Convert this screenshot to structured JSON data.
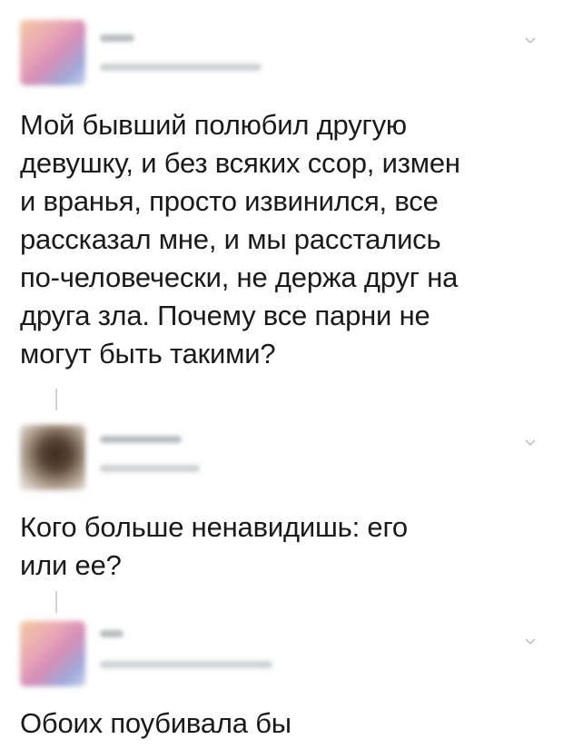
{
  "posts": [
    {
      "icon": "chevron-down-icon",
      "text": "Мой бывший полюбил другую\nдевушку, и без всяких ссор, измен\nи вранья, просто извинился, все\nрассказал мне, и мы расстались\nпо-человечески, не держа друг на\nдруга зла. Почему все парни не\nмогут быть такими?"
    },
    {
      "icon": "chevron-down-icon",
      "text": "Кого больше ненавидишь: его\nили ее?"
    },
    {
      "icon": "chevron-down-icon",
      "text": "Обоих поубивала бы"
    }
  ]
}
